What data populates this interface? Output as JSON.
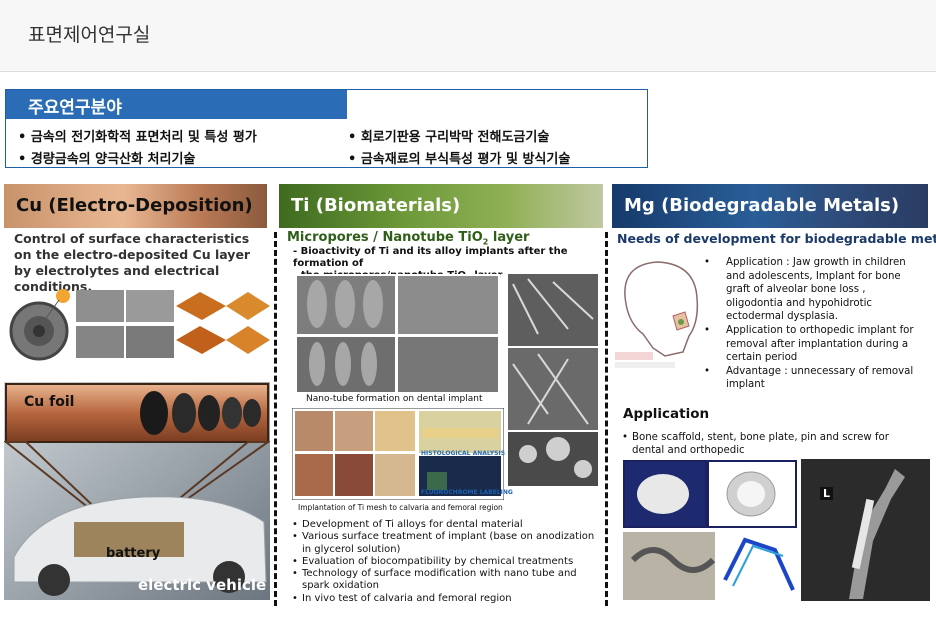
{
  "page": {
    "title": "표면제어연구실"
  },
  "research": {
    "heading": "주요연구분야",
    "items": [
      "• 금속의 전기화학적 표면처리 및 특성 평가",
      "• 회로기판용 구리박막 전해도금기술",
      "• 경량금속의 양극산화 처리기술",
      "• 금속재료의 부식특성 평가 및 방식기술"
    ]
  },
  "cu": {
    "heading": "Cu (Electro-Deposition)",
    "description": "Control of surface characteristics on the electro-deposited Cu layer by electrolytes and electrical conditions.",
    "foil_label": "Cu foil",
    "battery_label": "battery",
    "vehicle_label": "electric vehicle"
  },
  "ti": {
    "heading": "Ti (Biomaterials)",
    "subheading": "Micropores / Nanotube TiO",
    "subheading_sub": "2",
    "subheading_tail": " layer",
    "bio_line1": "-  Bioactivity of Ti and its alloy implants after the formation of",
    "bio_line2": "the micropores/nanotube TiO",
    "bio_line2_sub": "2",
    "bio_line2_tail": " layer",
    "caption_top": "Nano-tube formation on dental implant",
    "caption_bottom": "Implantation of Ti mesh to calvaria and femoral region",
    "hist_label": "HISTOLOGICAL ANALYSIS",
    "fluoro_label": "FLUOROCHROME LABELING",
    "list": [
      "Development of Ti alloys for dental material",
      "Various surface treatment of implant (base on anodization in glycerol solution)",
      "Evaluation of biocompatibility by chemical treatments",
      "Technology of surface modification with nano tube and spark oxidation",
      "In vivo test of calvaria and femoral region"
    ]
  },
  "mg": {
    "heading": "Mg (Biodegradable Metals)",
    "subheading": "Needs of development for biodegradable metal",
    "list": [
      "Application : Jaw growth in children and adolescents, Implant for bone graft of alveolar bone loss , oligodontia and hypohidrotic ectodermal dysplasia.",
      "Application to orthopedic implant for removal after implantation during a certain period",
      "Advantage : unnecessary  of removal implant"
    ],
    "application_heading": "Application",
    "application_text": "Bone scaffold, stent, bone plate, pin and screw for dental and orthopedic",
    "xray_label": "L"
  },
  "colors": {
    "research_blue": "#2a6cb5",
    "ti_green": "#2f5e18",
    "mg_navy": "#1b3a6a"
  }
}
